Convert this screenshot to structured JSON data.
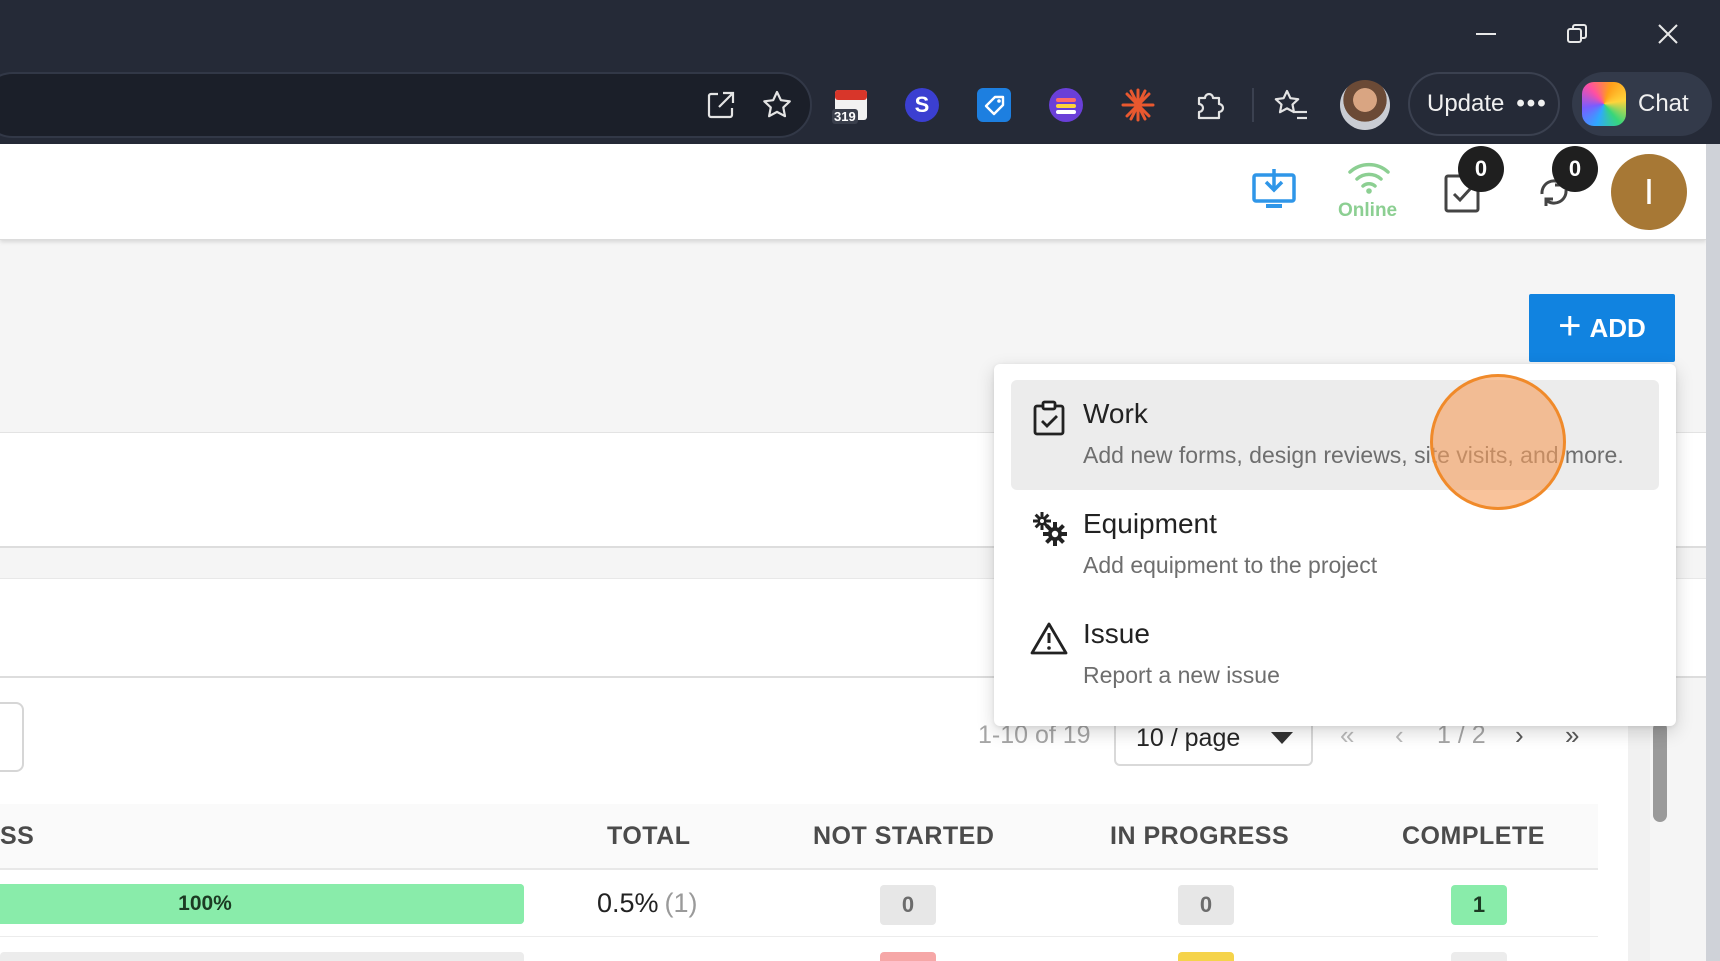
{
  "browser": {
    "extensions": [
      {
        "name": "calendar-extension",
        "badge": "319"
      },
      {
        "name": "s-extension",
        "letter": "S"
      },
      {
        "name": "tag-extension"
      },
      {
        "name": "stack-extension"
      },
      {
        "name": "asterisk-extension"
      },
      {
        "name": "puzzle-extension"
      },
      {
        "name": "favorites"
      }
    ],
    "update_label": "Update",
    "update_more": "•••",
    "chat_label": "Chat"
  },
  "header": {
    "online_label": "Online",
    "tasks_count": "0",
    "sync_count": "0",
    "user_initial": "I",
    "colors": {
      "online": "#8ccf92",
      "download": "#2f96e8",
      "avatar": "#a77835"
    }
  },
  "toolbar": {
    "add_label": "ADD",
    "add_color": "#1183e0"
  },
  "add_menu": {
    "items": [
      {
        "icon": "clipboard-check-icon",
        "title": "Work",
        "description": "Add new forms, design reviews, site visits, and more.",
        "highlighted": true
      },
      {
        "icon": "gears-icon",
        "title": "Equipment",
        "description": "Add equipment to the project",
        "highlighted": false
      },
      {
        "icon": "warning-triangle-icon",
        "title": "Issue",
        "description": "Report a new issue",
        "highlighted": false
      }
    ]
  },
  "pagination": {
    "range": "1-10 of 19",
    "page_size": "10 / page",
    "first": "«",
    "prev": "‹",
    "current": "1 / 2",
    "next": "›",
    "last": "»"
  },
  "table": {
    "columns": [
      "SS",
      "TOTAL",
      "NOT STARTED",
      "IN PROGRESS",
      "COMPLETE"
    ],
    "rows": [
      {
        "progress_pct": 100,
        "progress_label": "100%",
        "total": "0.5%",
        "total_count": "(1)",
        "not_started": "0",
        "in_progress": "0",
        "complete": "1"
      }
    ]
  }
}
